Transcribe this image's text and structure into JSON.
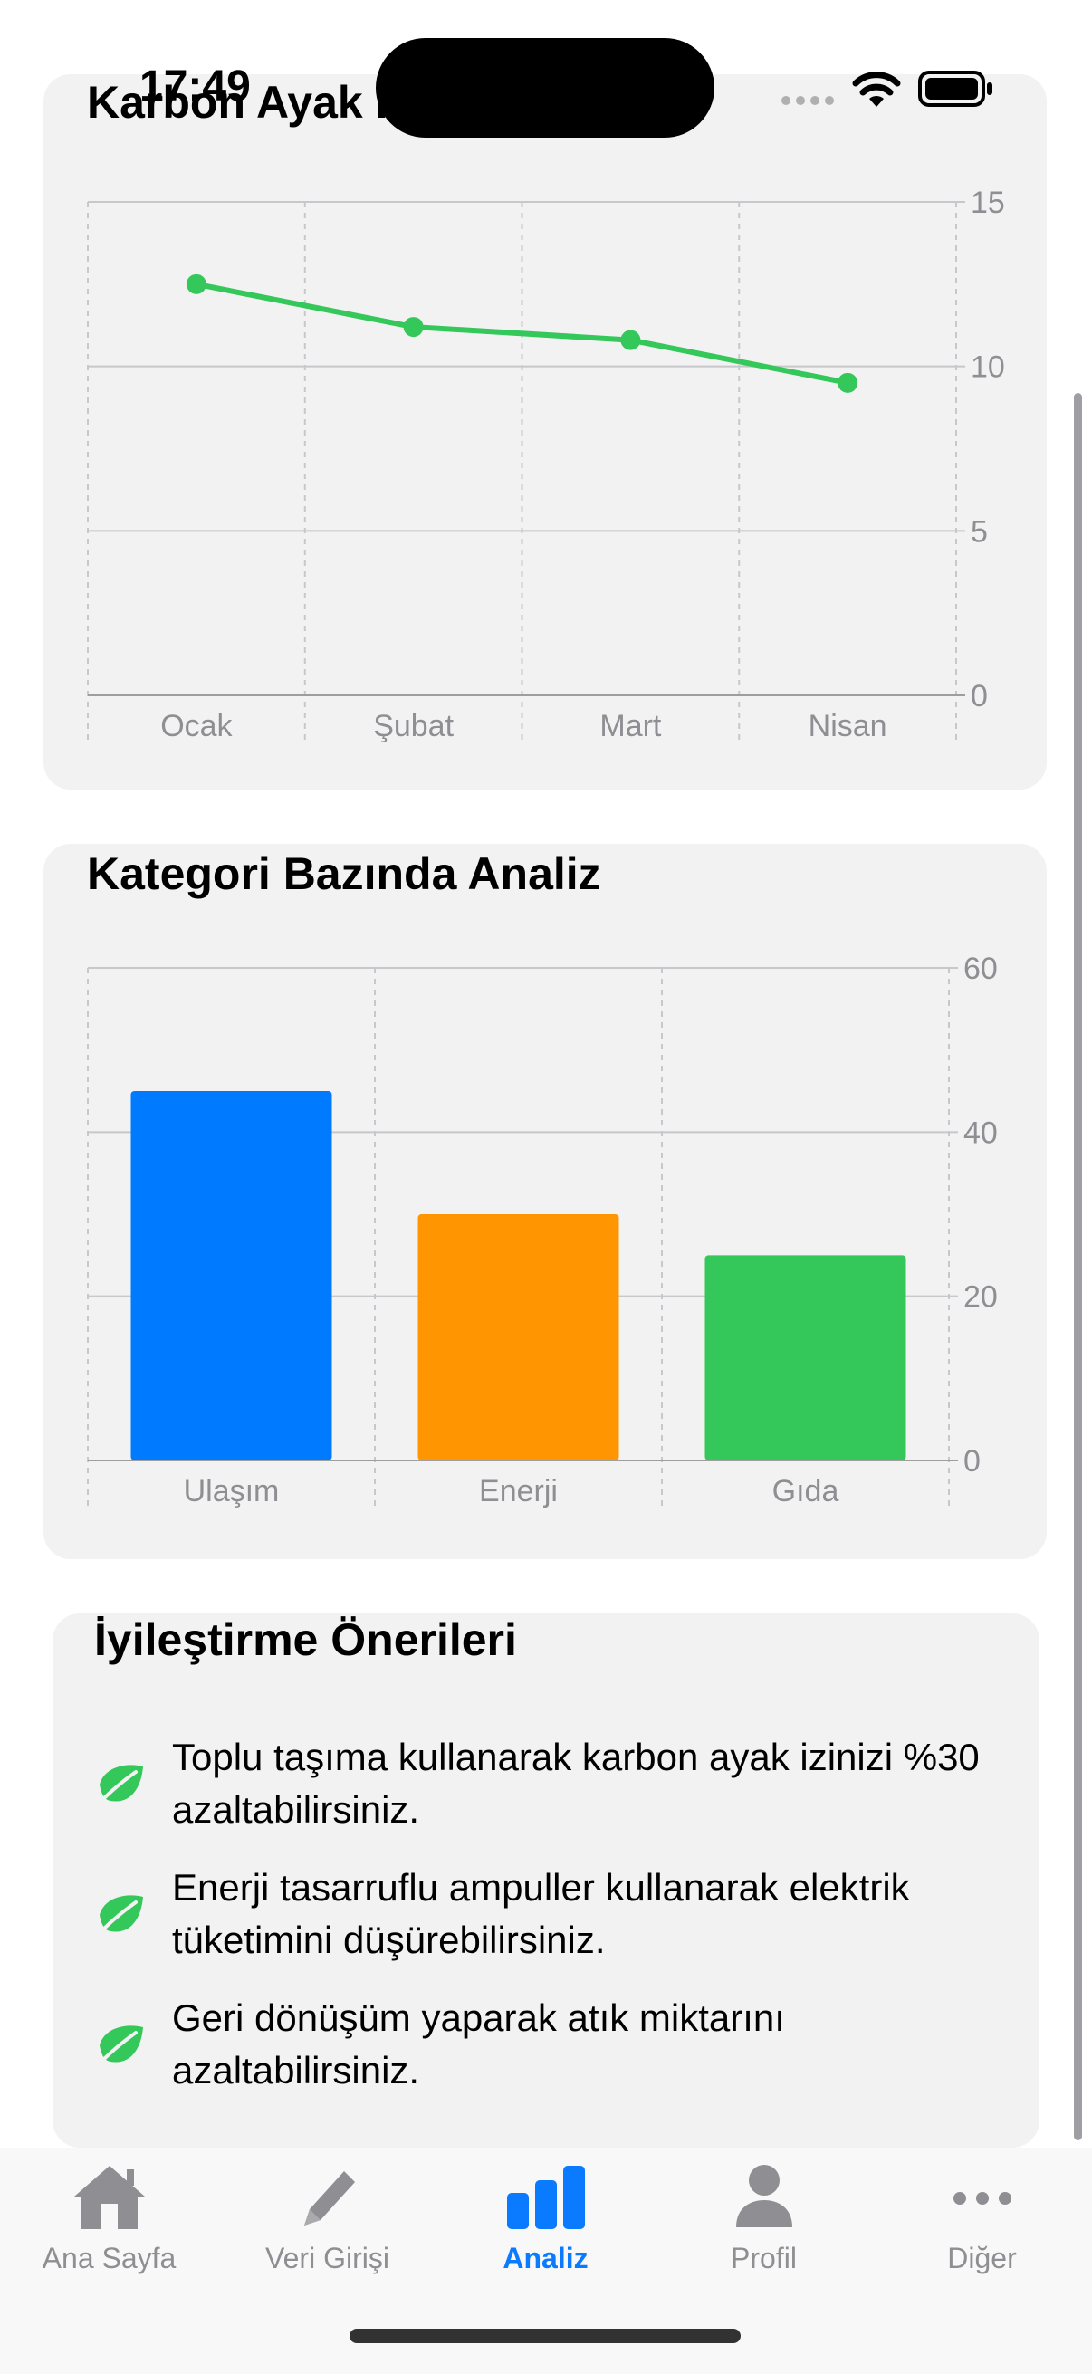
{
  "status_bar": {
    "time": "17:49"
  },
  "line_card": {
    "title": "Karbon Ayak İzi",
    "chart_data": {
      "type": "line",
      "title": "Karbon Ayak İzi",
      "categories": [
        "Ocak",
        "Şubat",
        "Mart",
        "Nisan"
      ],
      "series": [
        {
          "values": [
            12.5,
            11.2,
            10.8,
            9.5
          ],
          "color": "#34c759"
        }
      ],
      "ylim": [
        0,
        15
      ],
      "yticks": [
        "0",
        "5",
        "10",
        "15"
      ],
      "grid": true
    }
  },
  "bar_card": {
    "title": "Kategori Bazında Analiz",
    "chart_data": {
      "type": "bar",
      "title": "Kategori Bazında Analiz",
      "categories": [
        "Ulaşım",
        "Enerji",
        "Gıda"
      ],
      "values": [
        45,
        30,
        25
      ],
      "colors": [
        "#007aff",
        "#ff9500",
        "#34c759"
      ],
      "ylim": [
        0,
        60
      ],
      "yticks": [
        "0",
        "20",
        "40",
        "60"
      ],
      "grid": true
    }
  },
  "tips_card": {
    "title": "İyileştirme Önerileri",
    "icon": "leaf-icon",
    "accent": "#34c759",
    "items": [
      {
        "text": "Toplu taşıma kullanarak karbon ayak izinizi %30 azaltabilirsiniz."
      },
      {
        "text": "Enerji tasarruflu ampuller kullanarak elektrik tüketimini düşürebilirsiniz."
      },
      {
        "text": "Geri dönüşüm yaparak atık miktarını azaltabilirsiniz."
      }
    ]
  },
  "tab_bar": {
    "active_color": "#0a7aff",
    "inactive_color": "#8e8e93",
    "tabs": [
      {
        "label": "Ana Sayfa",
        "icon": "house-icon",
        "active": false
      },
      {
        "label": "Veri Girişi",
        "icon": "pencil-icon",
        "active": false
      },
      {
        "label": "Analiz",
        "icon": "chart-bar-icon",
        "active": true
      },
      {
        "label": "Profil",
        "icon": "person-icon",
        "active": false
      },
      {
        "label": "Diğer",
        "icon": "ellipsis-icon",
        "active": false
      }
    ]
  }
}
